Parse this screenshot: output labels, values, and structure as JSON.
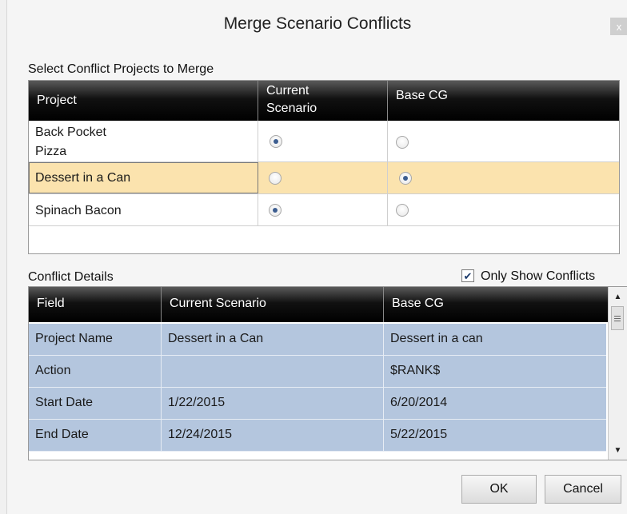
{
  "window": {
    "title": "Merge Scenario Conflicts",
    "close_glyph": "x"
  },
  "projects_section": {
    "label": "Select Conflict Projects to Merge",
    "columns": [
      "Project",
      "Current Scenario",
      "Base CG"
    ],
    "column_lines": [
      [
        "Project"
      ],
      [
        "Current",
        "Scenario"
      ],
      [
        "Base CG"
      ]
    ],
    "rows": [
      {
        "lines": [
          "Back Pocket",
          "Pizza"
        ],
        "current_selected": true,
        "base_selected": false,
        "highlighted": false
      },
      {
        "lines": [
          "Dessert in a Can"
        ],
        "current_selected": false,
        "base_selected": true,
        "highlighted": true
      },
      {
        "lines": [
          "Spinach Bacon"
        ],
        "current_selected": true,
        "base_selected": false,
        "highlighted": false
      }
    ]
  },
  "details_section": {
    "label": "Conflict Details",
    "only_show_conflicts": {
      "label": "Only Show Conflicts",
      "checked": true
    },
    "columns": [
      "Field",
      "Current Scenario",
      "Base CG"
    ],
    "rows": [
      [
        "Project Name",
        "Dessert in a Can",
        "Dessert in a can"
      ],
      [
        "Action",
        "",
        "$RANK$"
      ],
      [
        "Start Date",
        "1/22/2015",
        "6/20/2014"
      ],
      [
        "End Date",
        "12/24/2015",
        "5/22/2015"
      ]
    ]
  },
  "buttons": {
    "ok": "OK",
    "cancel": "Cancel"
  },
  "colors": {
    "header_bg": "#000000",
    "selected_row": "#fbe3ae",
    "detail_row": "#b4c6de"
  }
}
